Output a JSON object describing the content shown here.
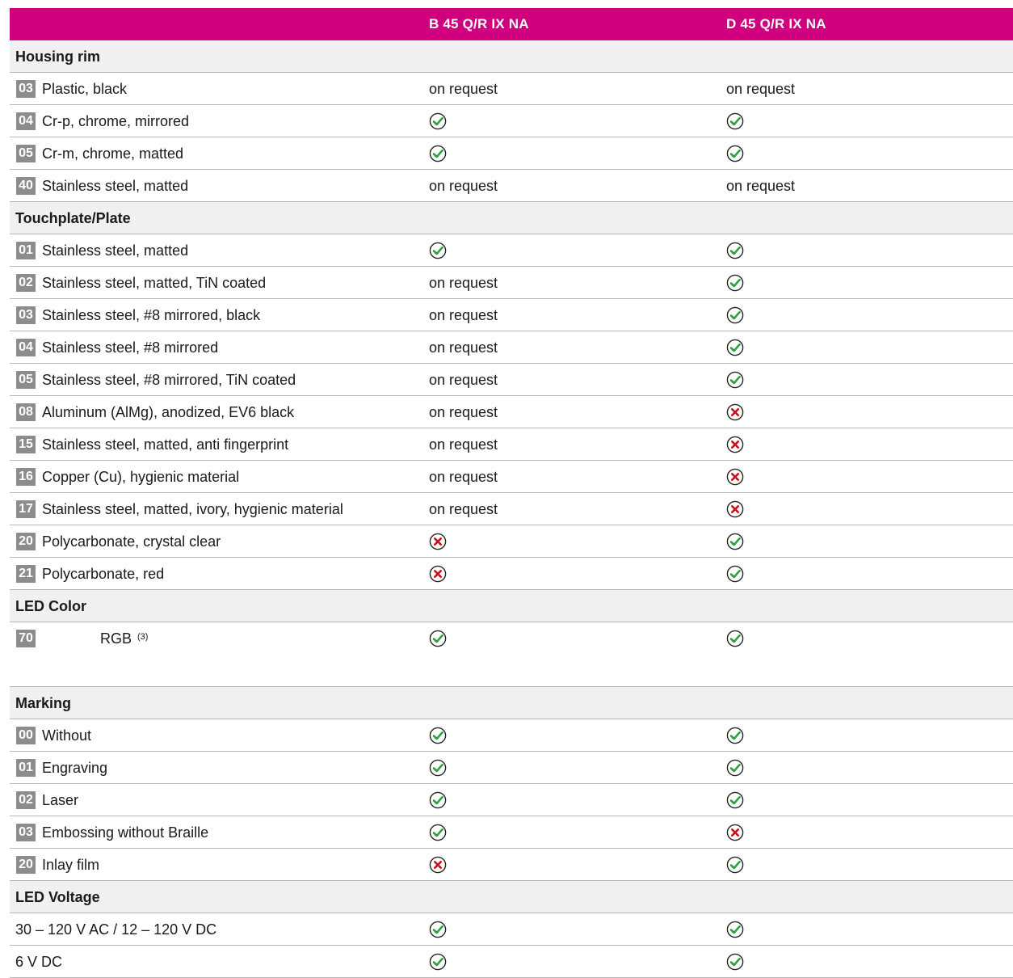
{
  "header": {
    "col1": "B 45 Q/R IX NA",
    "col2": "D 45 Q/R IX NA"
  },
  "colors": {
    "header_bg": "#d0007f",
    "check": "#2e9e3a",
    "cross": "#d10f1f",
    "code_bg": "#8c8c8c"
  },
  "sections": [
    {
      "title": "Housing rim",
      "rows": [
        {
          "code": "03",
          "label": "Plastic, black",
          "v1": "on request",
          "v2": "on request"
        },
        {
          "code": "04",
          "label": "Cr-p, chrome, mirrored",
          "v1": "check",
          "v2": "check"
        },
        {
          "code": "05",
          "label": "Cr-m, chrome, matted",
          "v1": "check",
          "v2": "check"
        },
        {
          "code": "40",
          "label": "Stainless steel, matted",
          "v1": "on request",
          "v2": "on request"
        }
      ]
    },
    {
      "title": "Touchplate/Plate",
      "rows": [
        {
          "code": "01",
          "label": "Stainless steel, matted",
          "v1": "check",
          "v2": "check"
        },
        {
          "code": "02",
          "label": "Stainless steel, matted, TiN coated",
          "v1": "on request",
          "v2": "check"
        },
        {
          "code": "03",
          "label": "Stainless steel, #8 mirrored, black",
          "v1": "on request",
          "v2": "check"
        },
        {
          "code": "04",
          "label": "Stainless steel, #8 mirrored",
          "v1": "on request",
          "v2": "check"
        },
        {
          "code": "05",
          "label": "Stainless steel, #8 mirrored, TiN coated",
          "v1": "on request",
          "v2": "check"
        },
        {
          "code": "08",
          "label": "Aluminum (AlMg), anodized, EV6 black",
          "v1": "on request",
          "v2": "cross"
        },
        {
          "code": "15",
          "label": "Stainless steel, matted, anti fingerprint",
          "v1": "on request",
          "v2": "cross"
        },
        {
          "code": "16",
          "label": "Copper (Cu), hygienic material",
          "v1": "on request",
          "v2": "cross"
        },
        {
          "code": "17",
          "label": "Stainless steel, matted, ivory, hygienic material",
          "v1": "on request",
          "v2": "cross"
        },
        {
          "code": "20",
          "label": "Polycarbonate, crystal clear",
          "v1": "cross",
          "v2": "check"
        },
        {
          "code": "21",
          "label": "Polycarbonate, red",
          "v1": "cross",
          "v2": "check"
        }
      ]
    },
    {
      "title": "LED Color",
      "rows": [
        {
          "code": "70",
          "label": "RGB",
          "sup": "(3)",
          "v1": "check",
          "v2": "check",
          "rgb": true
        }
      ]
    },
    {
      "title": "Marking",
      "rows": [
        {
          "code": "00",
          "label": "Without",
          "v1": "check",
          "v2": "check"
        },
        {
          "code": "01",
          "label": "Engraving",
          "v1": "check",
          "v2": "check"
        },
        {
          "code": "02",
          "label": "Laser",
          "v1": "check",
          "v2": "check"
        },
        {
          "code": "03",
          "label": "Embossing without Braille",
          "v1": "check",
          "v2": "cross"
        },
        {
          "code": "20",
          "label": "Inlay film",
          "v1": "cross",
          "v2": "check"
        }
      ]
    },
    {
      "title": "LED Voltage",
      "rows": [
        {
          "code": "",
          "label": "30 – 120 V AC / 12 – 120 V DC",
          "v1": "check",
          "v2": "check"
        },
        {
          "code": "",
          "label": "6 V DC",
          "v1": "check",
          "v2": "check"
        }
      ]
    }
  ]
}
